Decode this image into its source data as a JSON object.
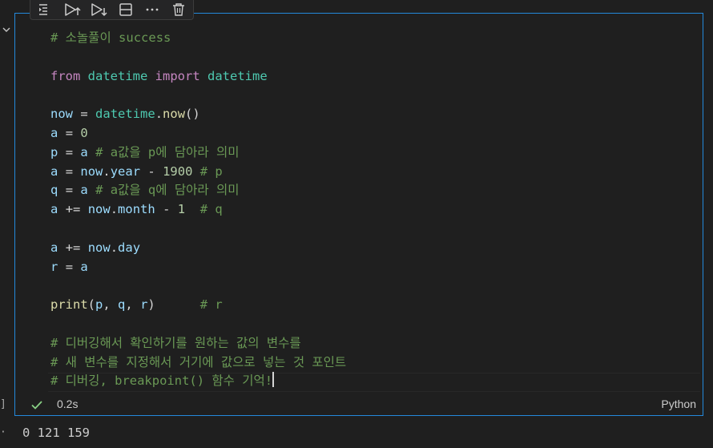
{
  "toolbar": {
    "buttons": [
      {
        "name": "run-by-line",
        "icon": "run-by-line-icon"
      },
      {
        "name": "execute-above",
        "icon": "execute-above-icon"
      },
      {
        "name": "execute-below",
        "icon": "execute-below-icon"
      },
      {
        "name": "split-cell",
        "icon": "split-cell-icon"
      },
      {
        "name": "more-actions",
        "icon": "more-icon"
      },
      {
        "name": "delete-cell",
        "icon": "trash-icon"
      }
    ]
  },
  "cell": {
    "execution_count_fragment": "]",
    "status": {
      "state": "success",
      "duration": "0.2s"
    },
    "language": "Python",
    "code_lines": [
      "# 소놀풀이 success",
      "",
      "from datetime import datetime",
      "",
      "now = datetime.now()",
      "a = 0",
      "p = a # a값을 p에 담아라 의미",
      "a = now.year - 1900 # p",
      "q = a # a값을 q에 담아라 의미",
      "a += now.month - 1  # q",
      "",
      "a += now.day",
      "r = a",
      "",
      "print(p, q, r)      # r",
      "",
      "# 디버깅해서 확인하기를 원하는 값의 변수를",
      "# 새 변수를 지정해서 거기에 값으로 넣는 것 포인트",
      "# 디버깅, breakpoint() 함수 기억!"
    ]
  },
  "output": {
    "marker": "·",
    "text": "0 121 159"
  },
  "colors": {
    "focus_border": "#2489db",
    "comment": "#6a9955",
    "keyword": "#c586c0",
    "module": "#4ec9b0",
    "function": "#dcdcaa",
    "number": "#b5cea8",
    "variable": "#9cdcfe",
    "success": "#89d185"
  }
}
